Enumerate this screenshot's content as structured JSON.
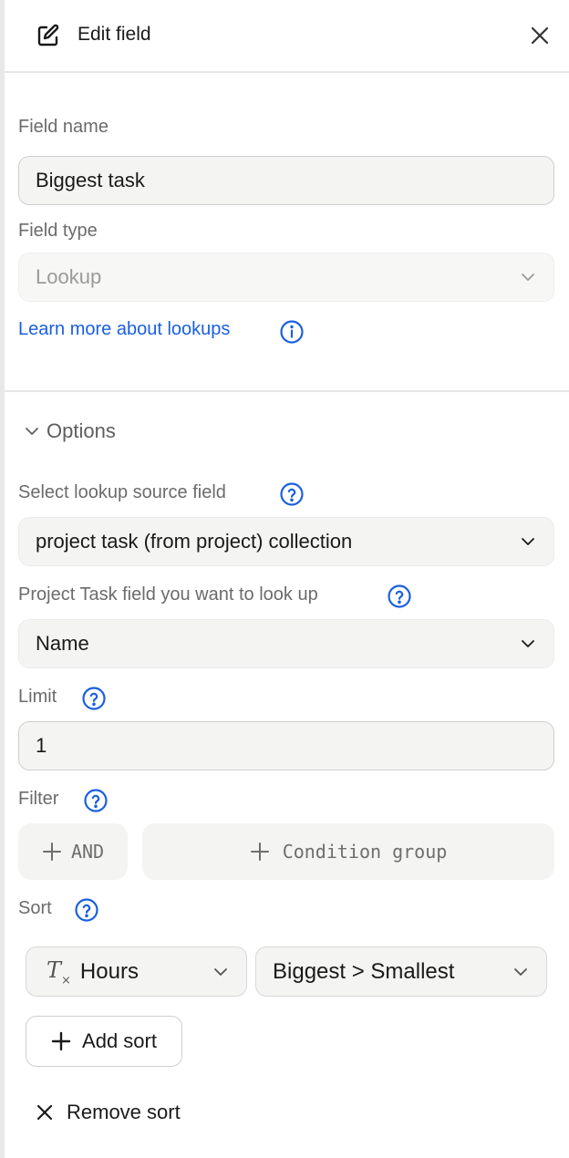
{
  "header": {
    "title": "Edit field",
    "edit_icon": "pencil-square-icon",
    "close_icon": "close-icon"
  },
  "field_name": {
    "label": "Field name",
    "value": "Biggest task"
  },
  "field_type": {
    "label": "Field type",
    "value": "Lookup"
  },
  "learn_more": {
    "text": "Learn more about lookups",
    "icon": "info-icon"
  },
  "options": {
    "toggle_label": "Options",
    "source_field": {
      "label": "Select lookup source field",
      "value": "project task (from project) collection"
    },
    "lookup_field": {
      "label": "Project Task field you want to look up",
      "value": "Name"
    },
    "limit": {
      "label": "Limit",
      "value": "1"
    },
    "filter": {
      "label": "Filter",
      "and_label": "AND",
      "group_label": "Condition group"
    },
    "sort": {
      "label": "Sort",
      "field_value": "Hours",
      "direction_value": "Biggest > Smallest",
      "add_label": "Add sort",
      "remove_label": "Remove sort"
    }
  },
  "colors": {
    "link": "#1a5fe0",
    "help": "#1a5fe0",
    "label": "#6b6b6b",
    "field_bg": "#f4f4f3"
  }
}
